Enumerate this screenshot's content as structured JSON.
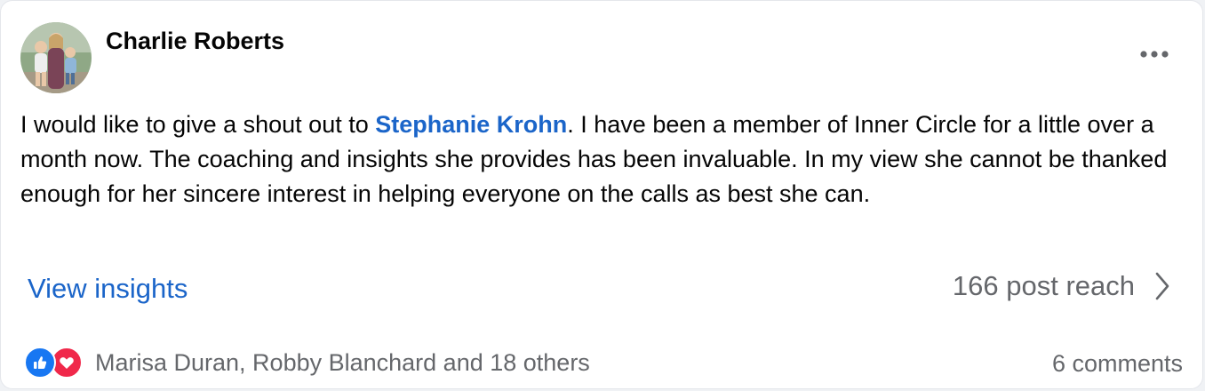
{
  "post": {
    "author": "Charlie Roberts",
    "text_before_mention": "I would like to give a shout out to ",
    "mention": "Stephanie Krohn",
    "text_after_mention": ". I have been a member of Inner Circle for a little over a month now. The coaching and insights she provides has been invaluable. In my view she cannot be thanked enough for her sincere interest in helping everyone on the calls as best she can."
  },
  "insights": {
    "view_label": "View insights",
    "reach_label": "166 post reach"
  },
  "footer": {
    "reactions_label": "Marisa Duran, Robby Blanchard and 18 others",
    "comments_label": "6 comments"
  },
  "icons": {
    "more": "more-options-icon",
    "chevron": "chevron-right-icon",
    "like": "like-reaction-icon",
    "love": "love-reaction-icon"
  },
  "colors": {
    "link": "#1b65c9",
    "like": "#1877f2",
    "love": "#f0284a",
    "secondary_text": "#65676b"
  }
}
